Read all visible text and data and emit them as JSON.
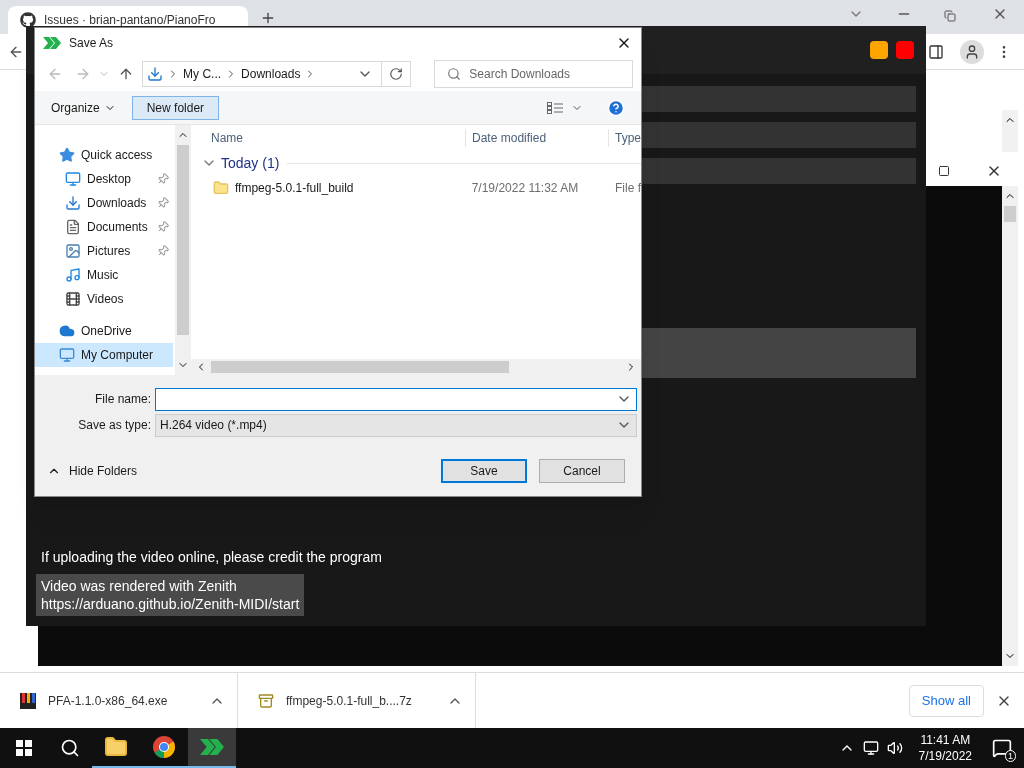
{
  "browser": {
    "tab": {
      "title": "Issues · brian-pantano/PianoFro"
    },
    "downloads": [
      {
        "kind": "piano",
        "name": "PFA-1.1.0-x86_64.exe"
      },
      {
        "kind": "archive",
        "name": "ffmpeg-5.0.1-full_b....7z"
      }
    ],
    "show_all": "Show all"
  },
  "app_window": {
    "notice": "If uploading the video online, please credit the program",
    "credit": [
      "Video was rendered with Zenith",
      "https://arduano.github.io/Zenith-MIDI/start"
    ]
  },
  "dialog": {
    "title": "Save As",
    "breadcrumb": [
      "My C...",
      "Downloads"
    ],
    "search_placeholder": "Search Downloads",
    "organize": "Organize",
    "new_folder": "New folder",
    "nav": [
      {
        "kind": "star",
        "label": "Quick access",
        "pinned": false,
        "selected": false,
        "children": [
          {
            "kind": "desktop",
            "label": "Desktop",
            "pinned": true,
            "selected": false
          },
          {
            "kind": "download",
            "label": "Downloads",
            "pinned": true,
            "selected": false
          },
          {
            "kind": "document",
            "label": "Documents",
            "pinned": true,
            "selected": false
          },
          {
            "kind": "picture",
            "label": "Pictures",
            "pinned": true,
            "selected": false
          },
          {
            "kind": "music",
            "label": "Music",
            "pinned": false,
            "selected": false
          },
          {
            "kind": "video",
            "label": "Videos",
            "pinned": false,
            "selected": false
          }
        ]
      },
      {
        "kind": "cloud",
        "label": "OneDrive",
        "pinned": false,
        "selected": false
      },
      {
        "kind": "computer",
        "label": "My Computer",
        "pinned": false,
        "selected": true
      }
    ],
    "columns": [
      "Name",
      "Date modified",
      "Type"
    ],
    "groups": [
      {
        "label": "Today (1)",
        "expanded": true,
        "rows": [
          {
            "name": "ffmpeg-5.0.1-full_build",
            "date": "7/19/2022 11:32 AM",
            "type": "File f"
          }
        ]
      }
    ],
    "file_name_label": "File name:",
    "save_type_label": "Save as type:",
    "save_type": "H.264 video (*.mp4)",
    "hide_folders": "Hide Folders",
    "buttons": [
      "Save",
      "Cancel"
    ]
  },
  "taskbar": {
    "apps": [
      {
        "kind": "folder",
        "selected": false
      },
      {
        "kind": "chrome",
        "selected": false
      },
      {
        "kind": "zenith",
        "selected": true
      }
    ],
    "time": "11:41 AM",
    "date": "7/19/2022",
    "notifications": "1"
  }
}
